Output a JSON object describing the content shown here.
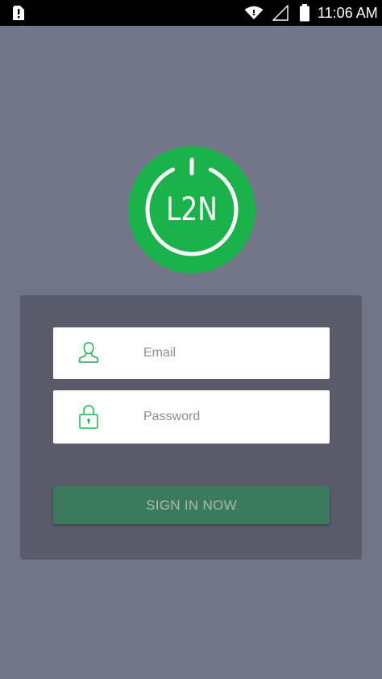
{
  "status_bar": {
    "time": "11:06 AM",
    "icons": [
      "sim-card-alert-icon",
      "wifi-icon",
      "signal-icon",
      "battery-icon"
    ]
  },
  "logo": {
    "text": "L2N",
    "color": "#1bb24b"
  },
  "login_form": {
    "email": {
      "placeholder": "Email",
      "value": "",
      "icon": "user-icon"
    },
    "password": {
      "placeholder": "Password",
      "value": "",
      "icon": "lock-icon"
    },
    "submit_label": "SIGN IN NOW"
  },
  "colors": {
    "background": "#727587",
    "card": "#5a5c6b",
    "accent": "#1bb24b",
    "button": "#3b7a5c",
    "button_text": "#a9b7b2"
  }
}
